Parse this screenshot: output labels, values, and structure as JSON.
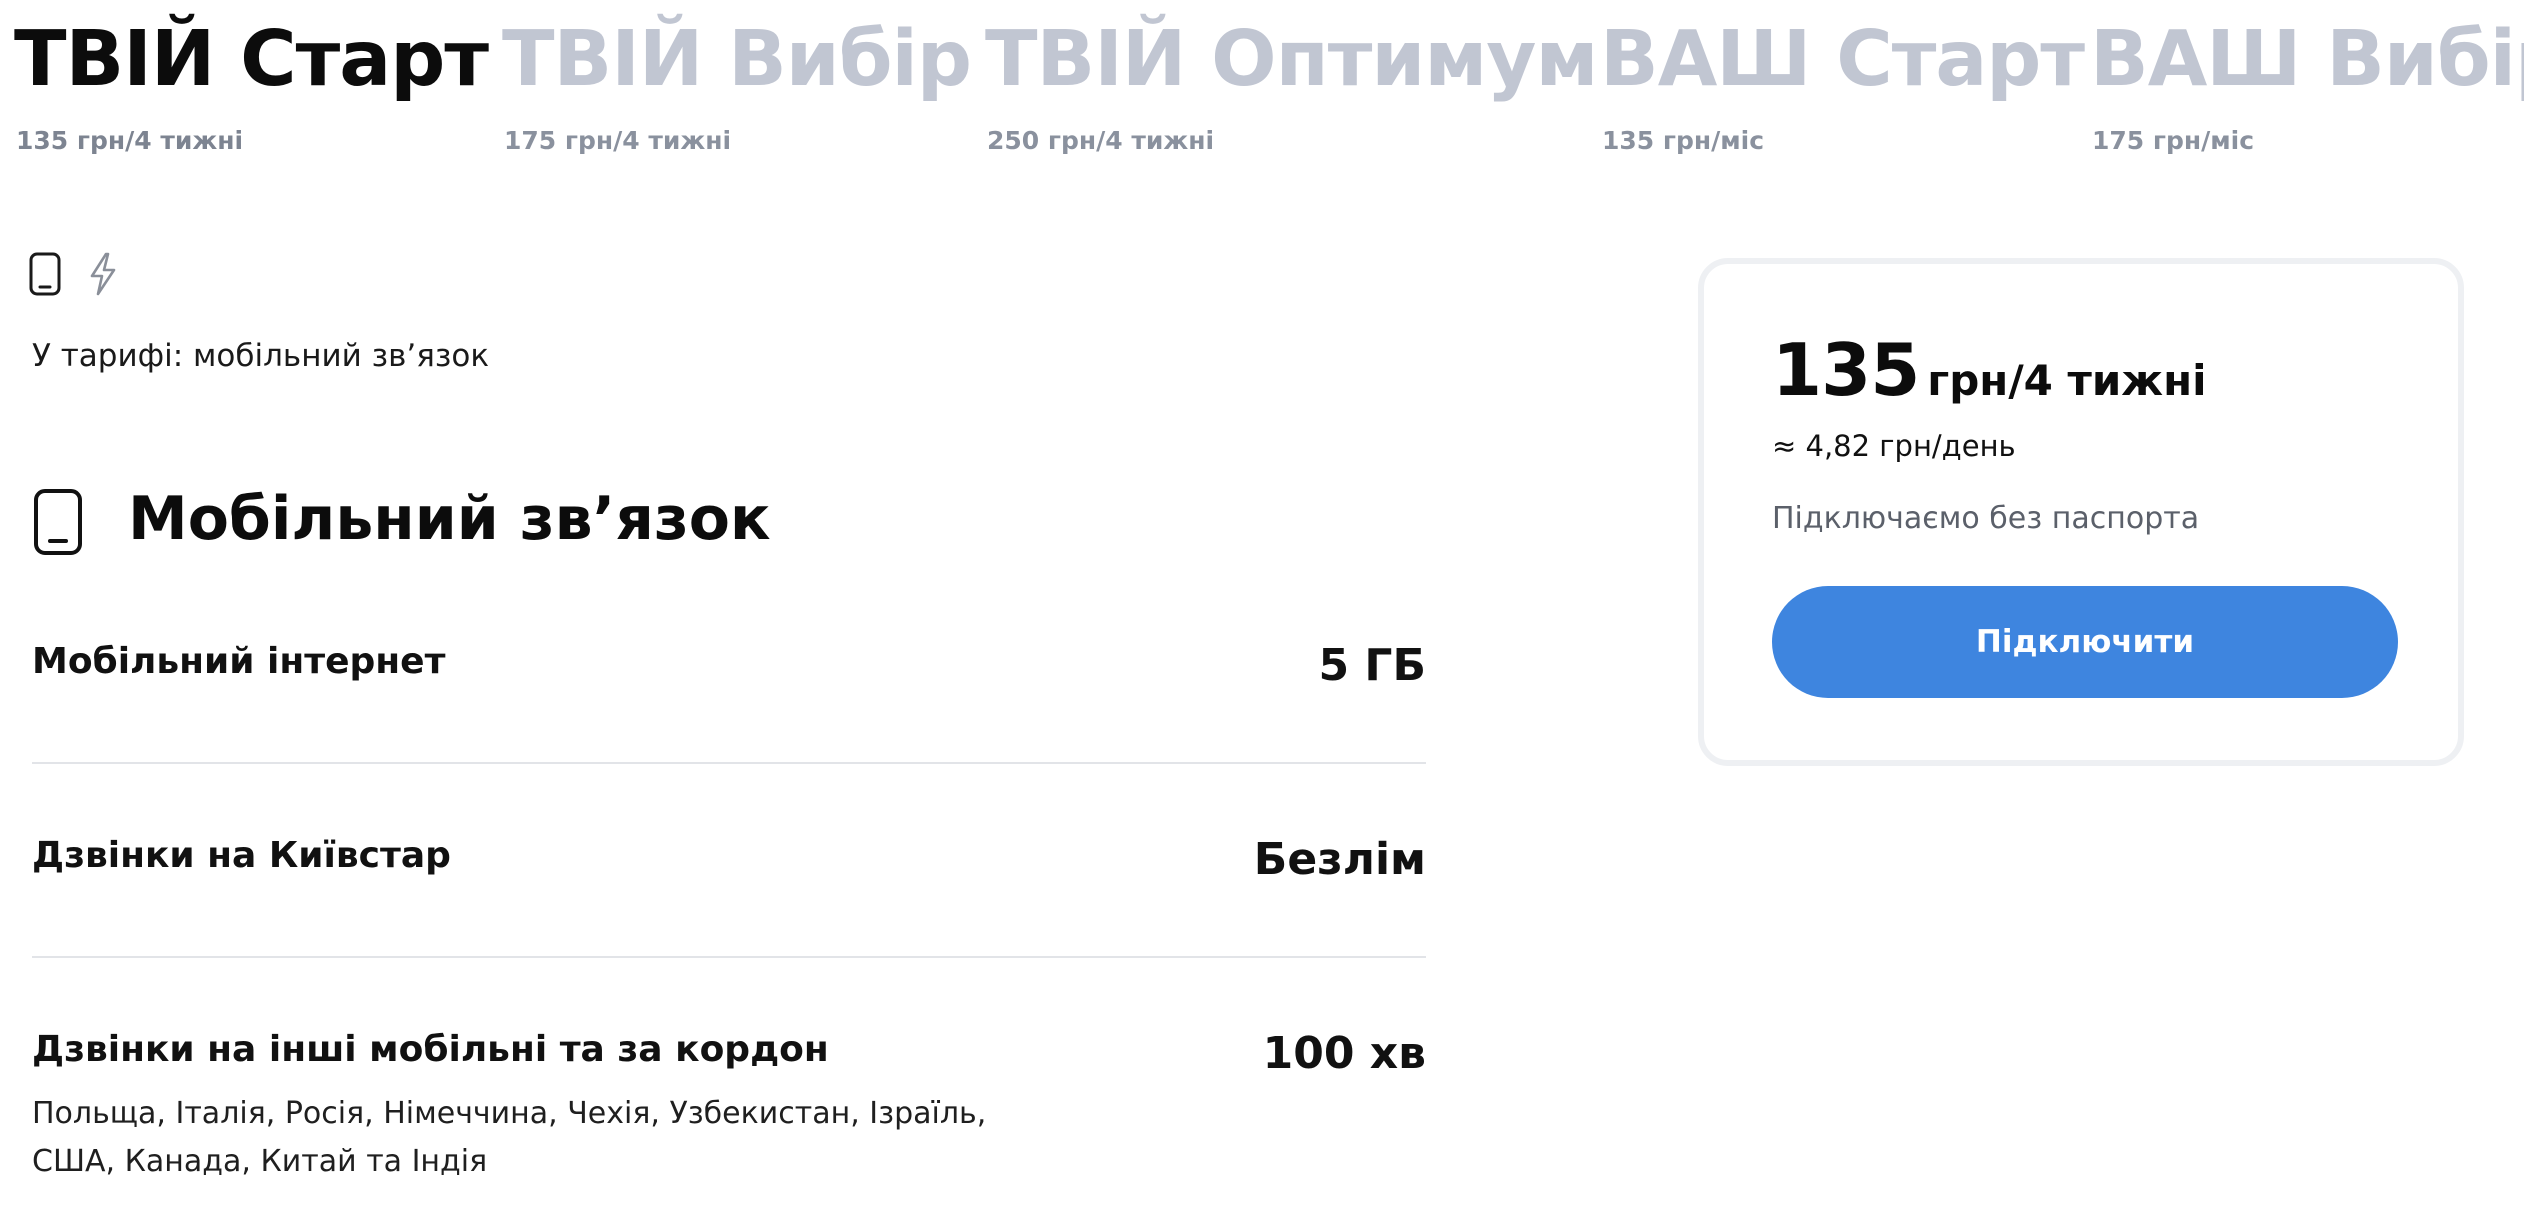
{
  "tabs": [
    {
      "name": "ТВІЙ Старт",
      "price": "135 грн/4 тижні",
      "active": true
    },
    {
      "name": "ТВІЙ Вибір",
      "price": "175 грн/4 тижні",
      "active": false
    },
    {
      "name": "ТВІЙ Оптимум",
      "price": "250 грн/4 тижні",
      "active": false
    },
    {
      "name": "ВАШ Старт",
      "price": "135 грн/міс",
      "active": false
    },
    {
      "name": "ВАШ Вибір",
      "price": "175 грн/міс",
      "active": false
    }
  ],
  "includes": {
    "icons": [
      "phone-icon",
      "lightning-icon"
    ],
    "text": "У тарифі: мобільний зв’язок"
  },
  "section": {
    "icon": "phone-icon",
    "title": "Мобільний зв’язок"
  },
  "features": [
    {
      "label": "Мобільний інтернет",
      "value": "5 ГБ"
    },
    {
      "label": "Дзвінки на Київстар",
      "value": "Безлім"
    },
    {
      "label": "Дзвінки на інші мобільні та за кордон",
      "value": "100 хв",
      "note": "Польща, Італія, Росія, Німеччина, Чехія, Узбекистан, Ізраїль, США, Канада, Китай та Індія"
    }
  ],
  "card": {
    "price_amount": "135",
    "price_unit": "грн/4 тижні",
    "per_day": "≈ 4,82 грн/день",
    "note": "Підключаємо без паспорта",
    "button_label": "Підключити"
  },
  "colors": {
    "accent": "#3e85df",
    "tab_inactive": "#c1c6d2",
    "tab_active": "#0c0c0c",
    "divider": "#e2e4e8",
    "muted": "#5b606a"
  }
}
